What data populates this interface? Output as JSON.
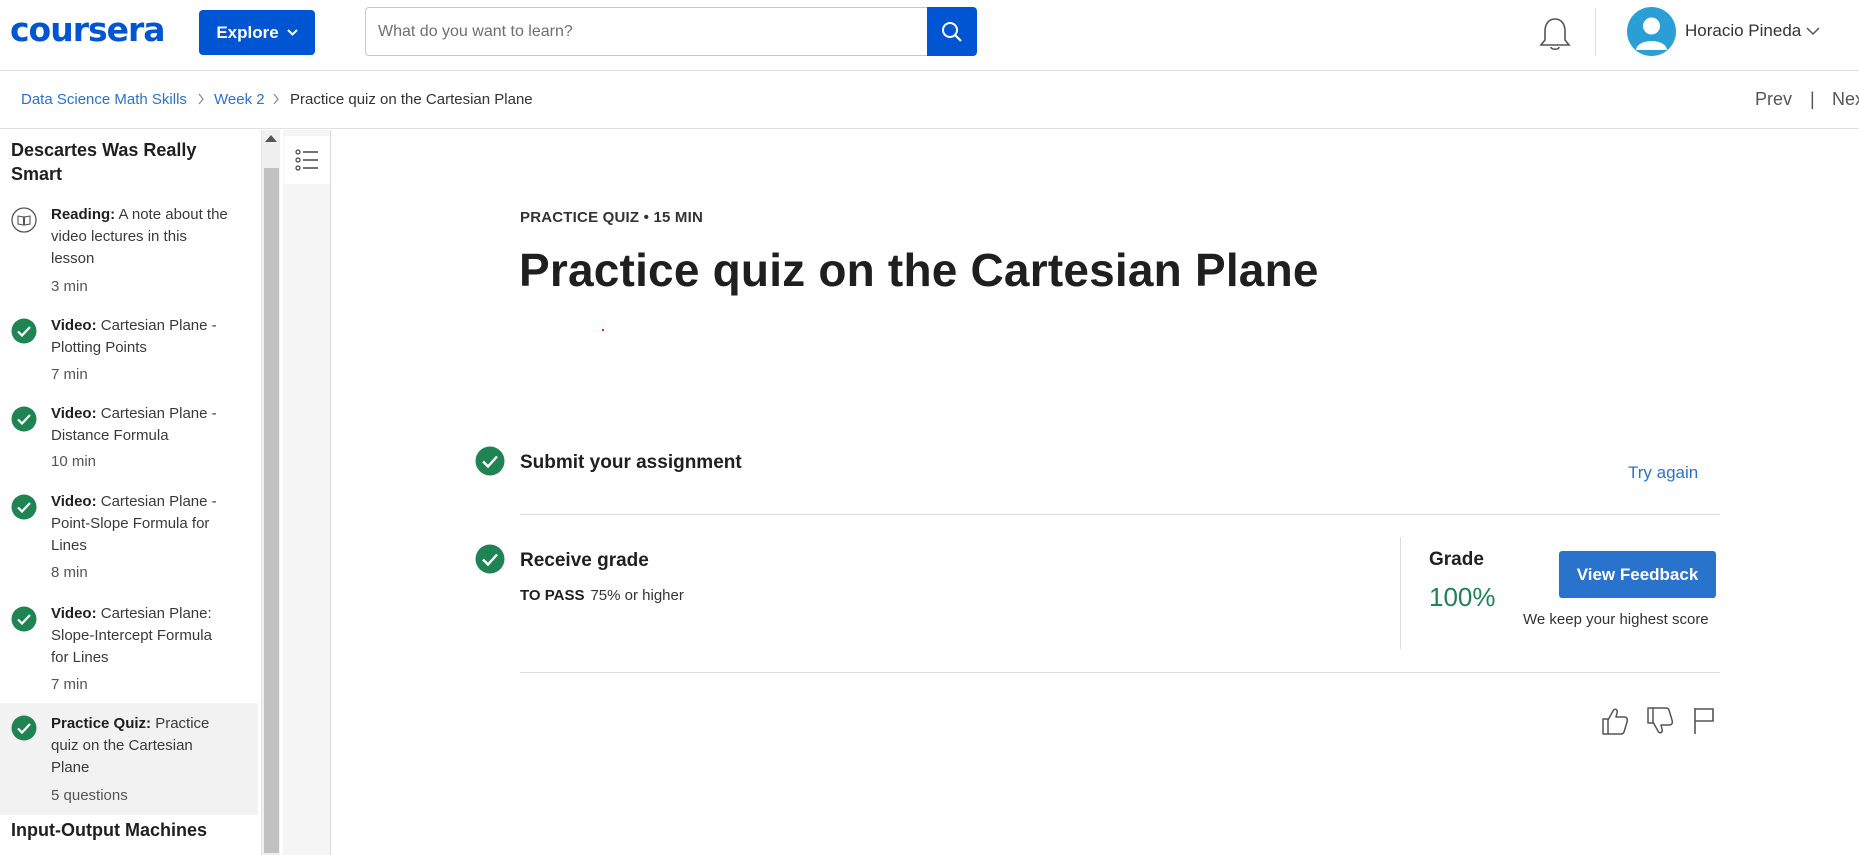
{
  "header": {
    "logo": "coursera",
    "explore_label": "Explore",
    "search_placeholder": "What do you want to learn?",
    "user_name": "Horacio Pineda",
    "icons": [
      "chevron-down-icon",
      "search-icon",
      "bell-icon",
      "avatar-icon"
    ]
  },
  "breadcrumb": {
    "course": "Data Science Math Skills",
    "week": "Week 2",
    "current": "Practice quiz on the Cartesian Plane",
    "prev": "Prev",
    "separator": "|",
    "next": "Nex"
  },
  "sidebar": {
    "lesson_title": "Descartes Was Really Smart",
    "items": [
      {
        "type": "Reading:",
        "title": "A note about the video lectures in this lesson",
        "duration": "3 min",
        "icon": "book-icon"
      },
      {
        "type": "Video:",
        "title": "Cartesian Plane - Plotting Points",
        "duration": "7 min",
        "icon": "check-circle-icon"
      },
      {
        "type": "Video:",
        "title": "Cartesian Plane - Distance Formula",
        "duration": "10 min",
        "icon": "check-circle-icon"
      },
      {
        "type": "Video:",
        "title": "Cartesian Plane - Point-Slope Formula for Lines",
        "duration": "8 min",
        "icon": "check-circle-icon"
      },
      {
        "type": "Video:",
        "title": "Cartesian Plane: Slope-Intercept Formula for Lines",
        "duration": "7 min",
        "icon": "check-circle-icon"
      },
      {
        "type": "Practice Quiz:",
        "title": "Practice quiz on the Cartesian Plane",
        "duration": "5 questions",
        "icon": "check-circle-icon",
        "active": true
      }
    ],
    "next_lesson_title": "Input-Output Machines"
  },
  "main": {
    "kicker": "PRACTICE QUIZ • 15 MIN",
    "title": "Practice quiz on the Cartesian Plane",
    "submit_step": {
      "title": "Submit your assignment",
      "action": "Try again"
    },
    "grade_step": {
      "title": "Receive grade",
      "to_pass_label": "TO PASS",
      "to_pass_value": "75% or higher",
      "grade_label": "Grade",
      "grade_value": "100%",
      "view_feedback": "View Feedback",
      "note": "We keep your highest score"
    }
  },
  "colors": {
    "brand": "#0056d2",
    "link": "#2a73cc",
    "success": "#1f8354"
  }
}
